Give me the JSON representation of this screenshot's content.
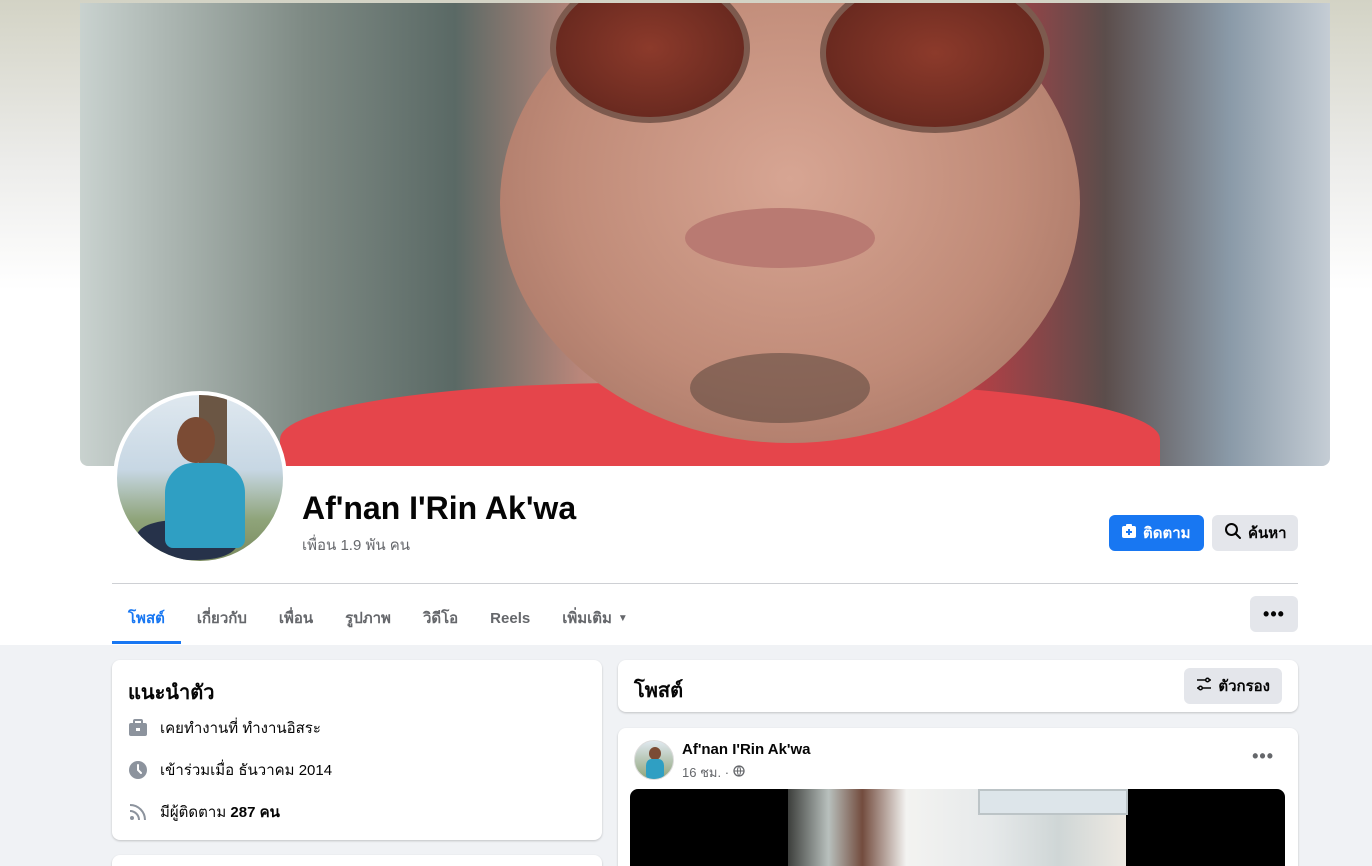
{
  "profile": {
    "name": "Af'nan I'Rin Ak'wa",
    "friends": "เพื่อน 1.9 พัน คน"
  },
  "actions": {
    "follow_label": "ติดตาม",
    "search_label": "ค้นหา",
    "more_icon": "more-dots-icon"
  },
  "tabs": [
    {
      "label": "โพสต์",
      "active": true
    },
    {
      "label": "เกี่ยวกับ"
    },
    {
      "label": "เพื่อน"
    },
    {
      "label": "รูปภาพ"
    },
    {
      "label": "วิดีโอ"
    },
    {
      "label": "Reels"
    },
    {
      "label": "เพิ่มเติม"
    }
  ],
  "intro": {
    "title": "แนะนำตัว",
    "work": "เคยทำงานที่ ทำงานอิสระ",
    "joined": "เข้าร่วมเมื่อ ธันวาคม 2014",
    "followers_prefix": "มีผู้ติดตาม",
    "followers_count": "287 คน"
  },
  "posts": {
    "title": "โพสต์",
    "filter_label": "ตัวกรอง",
    "items": [
      {
        "author": "Af'nan I'Rin Ak'wa",
        "time": "16 ชม. ·"
      }
    ]
  },
  "colors": {
    "accent": "#1877f2",
    "background": "#f0f2f5",
    "secondary_button": "#e4e6eb",
    "muted_text": "#65676b"
  }
}
